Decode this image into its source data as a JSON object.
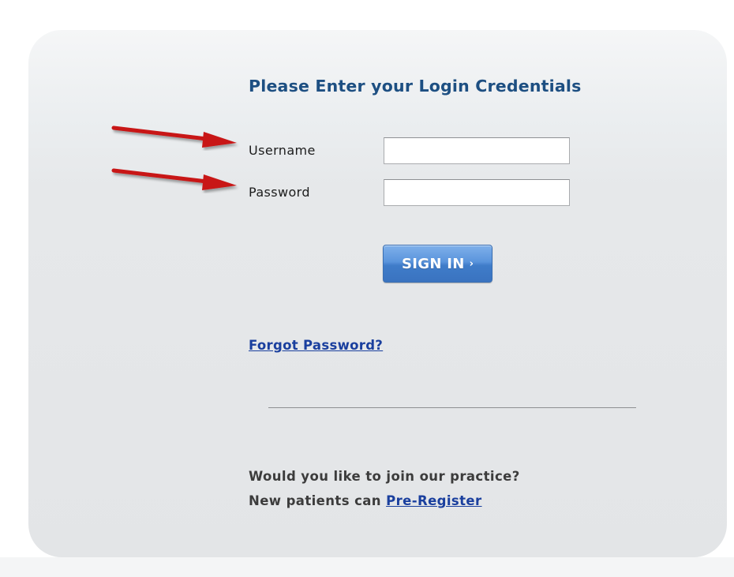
{
  "login": {
    "heading": "Please Enter your Login Credentials",
    "username_label": "Username",
    "username_value": "",
    "password_label": "Password",
    "password_value": "",
    "signin_label": "SIGN IN",
    "signin_chevron": "›",
    "forgot_link": "Forgot Password?"
  },
  "join": {
    "question": "Would you like to join our practice?",
    "new_patients_prefix": "New patients can",
    "preregister_link": "Pre-Register"
  },
  "colors": {
    "heading": "#1d4f82",
    "link": "#1a3f9e",
    "button": "#4a86d2",
    "annotation_arrow": "#c81414"
  },
  "annotations": {
    "arrows": [
      "red-arrow-to-username",
      "red-arrow-to-password"
    ]
  }
}
